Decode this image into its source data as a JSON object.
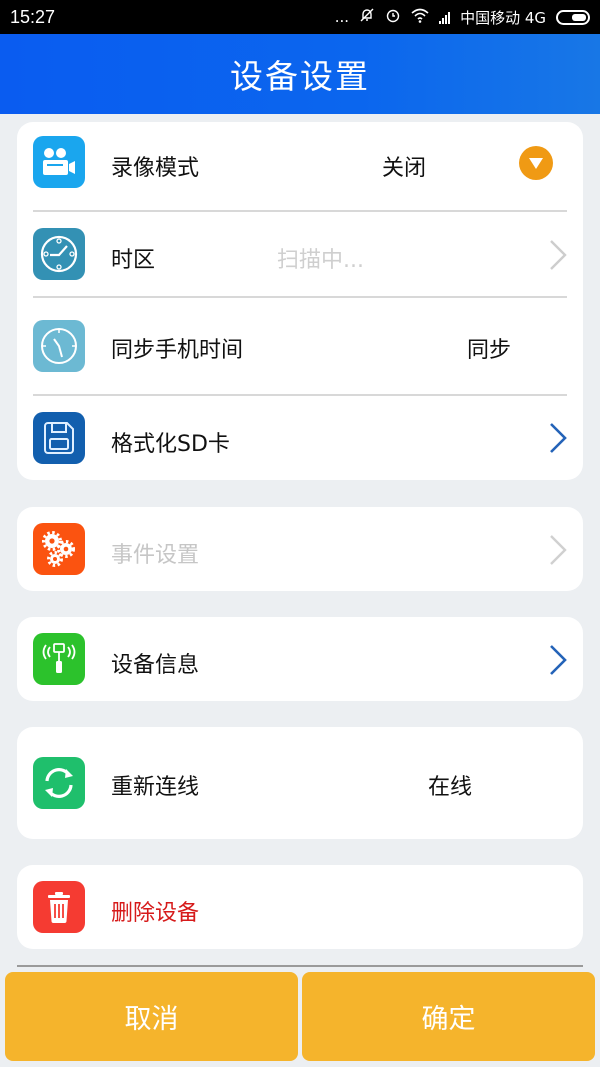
{
  "status_bar": {
    "time": "15:27",
    "dots": "...",
    "carrier": "中国移动 4G"
  },
  "header": {
    "title": "设备设置"
  },
  "settings": {
    "record_mode": {
      "label": "录像模式",
      "value": "关闭",
      "icon": "video-camera-icon",
      "icon_color": "#1aa6ee",
      "control": "dropdown-icon"
    },
    "timezone": {
      "label": "时区",
      "value": "扫描中...",
      "icon": "clock-icon",
      "icon_color": "#3391b4",
      "control": "chevron-right-icon"
    },
    "sync_time": {
      "label": "同步手机时间",
      "value": "同步",
      "icon": "clock-icon",
      "icon_color": "#6cb9d3"
    },
    "format_sd": {
      "label": "格式化SD卡",
      "icon": "floppy-disk-icon",
      "icon_color": "#125fae",
      "control": "chevron-right-icon"
    },
    "event_settings": {
      "label": "事件设置",
      "icon": "gears-icon",
      "icon_color": "#fb5310",
      "control": "chevron-right-icon",
      "disabled": true
    },
    "device_info": {
      "label": "设备信息",
      "icon": "antenna-icon",
      "icon_color": "#2cc22c",
      "control": "chevron-right-icon"
    },
    "reconnect": {
      "label": "重新连线",
      "value": "在线",
      "icon": "refresh-icon",
      "icon_color": "#1fbf6c"
    },
    "delete_device": {
      "label": "删除设备",
      "icon": "trash-icon",
      "icon_color": "#f53b32",
      "label_color": "#d61a1a"
    }
  },
  "footer": {
    "cancel_label": "取消",
    "confirm_label": "确定",
    "button_color": "#f5b42c"
  }
}
